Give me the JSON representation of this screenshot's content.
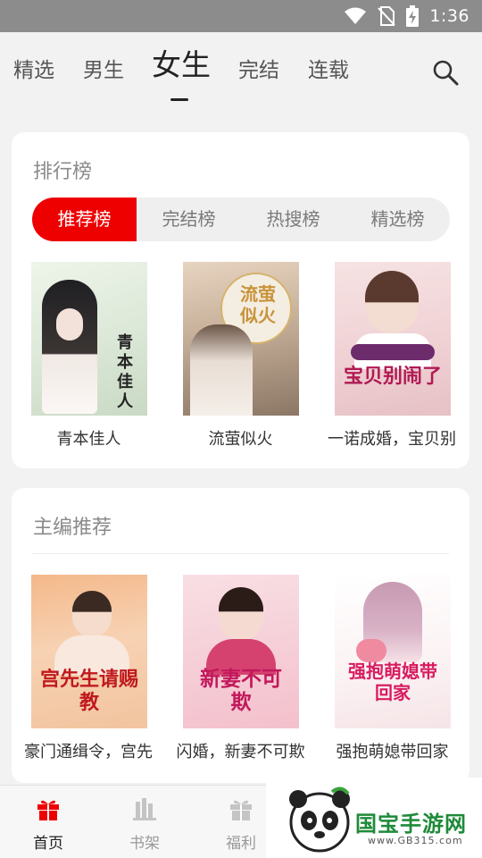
{
  "status_bar": {
    "time": "1:36",
    "icons": [
      "wifi-icon",
      "no-sim-icon",
      "battery-charging-icon"
    ]
  },
  "top_nav": {
    "tabs": [
      {
        "label": "精选",
        "active": false
      },
      {
        "label": "男生",
        "active": false
      },
      {
        "label": "女生",
        "active": true
      },
      {
        "label": "完结",
        "active": false
      },
      {
        "label": "连载",
        "active": false
      }
    ],
    "search_icon": "search-icon"
  },
  "ranking": {
    "title": "排行榜",
    "tabs": [
      {
        "label": "推荐榜",
        "active": true
      },
      {
        "label": "完结榜",
        "active": false
      },
      {
        "label": "热搜榜",
        "active": false
      },
      {
        "label": "精选榜",
        "active": false
      }
    ],
    "books": [
      {
        "title": "青本佳人",
        "cover_text": "青本佳人"
      },
      {
        "title": "流萤似火",
        "cover_text": "流萤似火"
      },
      {
        "title": "一诺成婚，宝贝别闹了",
        "cover_text": "宝贝别闹了"
      }
    ]
  },
  "editor": {
    "title": "主编推荐",
    "books": [
      {
        "title": "豪门通缉令，宫先生请赐教",
        "cover_text": "宫先生请赐教"
      },
      {
        "title": "闪婚，新妻不可欺",
        "cover_text": "新妻不可欺"
      },
      {
        "title": "强抱萌媳带回家",
        "cover_text": "强抱萌媳带回家"
      }
    ]
  },
  "bottom_tabs": [
    {
      "label": "首页",
      "icon": "gift-icon",
      "active": true
    },
    {
      "label": "书架",
      "icon": "bookshelf-icon",
      "active": false
    },
    {
      "label": "福利",
      "icon": "gift-icon",
      "active": false
    }
  ],
  "watermark": {
    "brand": "国宝手游网",
    "url": "www.GB315.com"
  },
  "colors": {
    "accent": "#ee0000",
    "background": "#f2f2f2",
    "status_bar": "#8c8c8c"
  }
}
